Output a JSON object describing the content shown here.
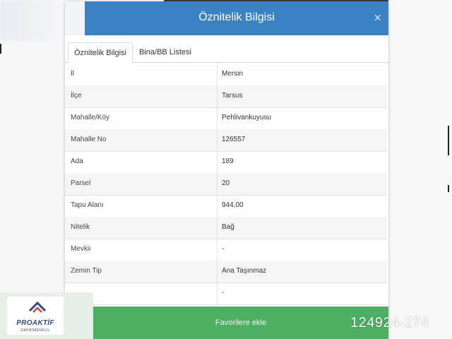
{
  "modal": {
    "title": "Öznitelik Bilgisi",
    "close_glyph": "×"
  },
  "tabs": [
    {
      "label": "Öznitelik Bilgisi",
      "active": true
    },
    {
      "label": "Bina/BB Listesi",
      "active": false
    }
  ],
  "attributes": [
    {
      "key": "İl",
      "value": "Mersin"
    },
    {
      "key": "İlçe",
      "value": "Tarsus"
    },
    {
      "key": "Mahalle/Köy",
      "value": "Pehlivankuyusu"
    },
    {
      "key": "Mahalle No",
      "value": "126557"
    },
    {
      "key": "Ada",
      "value": "189"
    },
    {
      "key": "Parsel",
      "value": "20"
    },
    {
      "key": "Tapu Alanı",
      "value": "944,00"
    },
    {
      "key": "Nitelik",
      "value": "Bağ"
    },
    {
      "key": "Mevkii",
      "value": "-"
    },
    {
      "key": "Zemin Tip",
      "value": "Ana Taşınmaz"
    },
    {
      "key": "",
      "value": "-"
    }
  ],
  "footer": {
    "button_label": "Favorilere ekle"
  },
  "watermark": {
    "brand": "PROAKTİF",
    "tagline": "GAYRİMENKUL",
    "reference": "124924-274"
  },
  "colors": {
    "header": "#3b82c4",
    "footer_button": "#4caf62",
    "logo_primary": "#2f4b8a",
    "logo_accent": "#d9443a"
  }
}
